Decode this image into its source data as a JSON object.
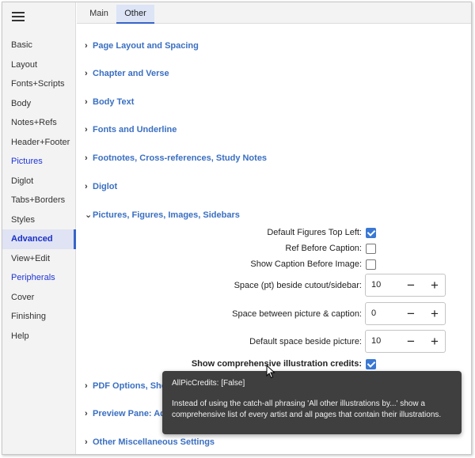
{
  "sidebar": {
    "items": [
      {
        "label": "Basic"
      },
      {
        "label": "Layout"
      },
      {
        "label": "Fonts+Scripts"
      },
      {
        "label": "Body"
      },
      {
        "label": "Notes+Refs"
      },
      {
        "label": "Header+Footer"
      },
      {
        "label": "Pictures"
      },
      {
        "label": "Diglot"
      },
      {
        "label": "Tabs+Borders"
      },
      {
        "label": "Styles"
      },
      {
        "label": "Advanced"
      },
      {
        "label": "View+Edit"
      },
      {
        "label": "Peripherals"
      },
      {
        "label": "Cover"
      },
      {
        "label": "Finishing"
      },
      {
        "label": "Help"
      }
    ],
    "active": "Advanced"
  },
  "tabs": [
    {
      "label": "Main"
    },
    {
      "label": "Other"
    }
  ],
  "sections": [
    {
      "label": "Page Layout and Spacing",
      "expanded": false
    },
    {
      "label": "Chapter and Verse",
      "expanded": false
    },
    {
      "label": "Body Text",
      "expanded": false
    },
    {
      "label": "Fonts and Underline",
      "expanded": false
    },
    {
      "label": "Footnotes, Cross-references, Study Notes",
      "expanded": false
    },
    {
      "label": "Diglot",
      "expanded": false
    },
    {
      "label": "Pictures, Figures, Images, Sidebars",
      "expanded": true
    },
    {
      "label": "PDF Options, Show",
      "expanded": false
    },
    {
      "label": "Preview Pane: Adju",
      "expanded": false
    },
    {
      "label": "Other Miscellaneous Settings",
      "expanded": false
    }
  ],
  "pictures_settings": {
    "default_figures_top_left": {
      "label": "Default Figures Top Left:",
      "checked": true
    },
    "ref_before_caption": {
      "label": "Ref Before Caption:",
      "checked": false
    },
    "show_caption_before_image": {
      "label": "Show Caption Before Image:",
      "checked": false
    },
    "space_beside_cutout": {
      "label": "Space (pt) beside cutout/sidebar:",
      "value": "10"
    },
    "space_between_picture_caption": {
      "label": "Space between picture & caption:",
      "value": "0"
    },
    "default_space_beside_picture": {
      "label": "Default space beside picture:",
      "value": "10"
    },
    "show_comprehensive_credits": {
      "label": "Show comprehensive illustration credits:",
      "checked": true
    }
  },
  "spinner_symbols": {
    "minus": "−",
    "plus": "+"
  },
  "tooltip": {
    "title": "AllPicCredits: [False]",
    "body": "Instead of using the catch-all phrasing 'All other illustrations by...' show a comprehensive list of every artist and all pages that contain their illustrations."
  },
  "colors": {
    "accent": "#3764c8",
    "section_text": "#3a6fc1",
    "checkbox_checked": "#3a78d4",
    "tooltip_bg": "#3f3f3f"
  }
}
